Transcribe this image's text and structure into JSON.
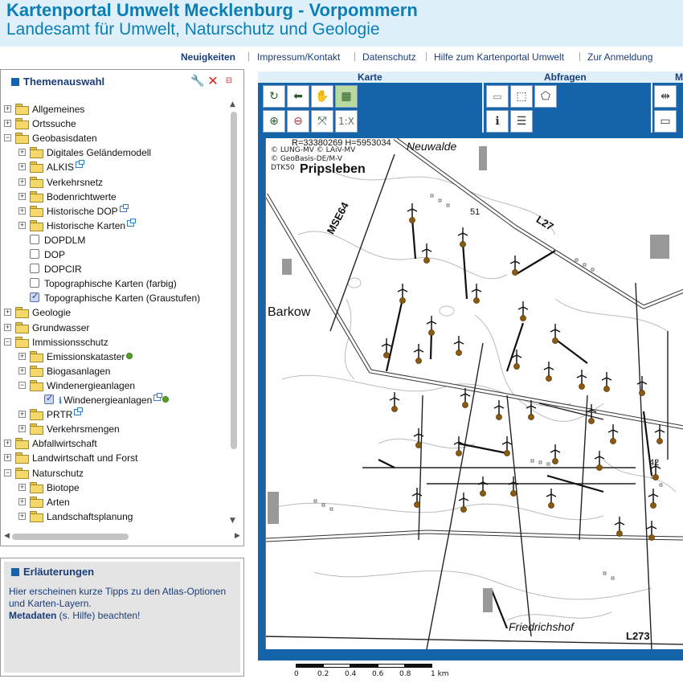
{
  "header": {
    "title": "Kartenportal Umwelt Mecklenburg - Vorpommern",
    "subtitle": "Landesamt für Umwelt, Naturschutz und Geologie"
  },
  "topnav": [
    "Neuigkeiten",
    "Impressum/Kontakt",
    "Datenschutz",
    "Hilfe zum Kartenportal Umwelt",
    "Zur Anmeldung"
  ],
  "theme_panel": {
    "title": "Themenauswahl",
    "tools": [
      "wrench-icon",
      "delete-icon",
      "collapse-icon"
    ],
    "tree": [
      {
        "label": "Allgemeines",
        "level": 0,
        "kind": "folder",
        "expander": "+"
      },
      {
        "label": "Ortssuche",
        "level": 0,
        "kind": "folder",
        "expander": "+"
      },
      {
        "label": "Geobasisdaten",
        "level": 0,
        "kind": "folder",
        "expander": "-"
      },
      {
        "label": "Digitales Geländemodell",
        "level": 1,
        "kind": "folder",
        "expander": "+"
      },
      {
        "label": "ALKIS",
        "level": 1,
        "kind": "folder",
        "expander": "+",
        "ext": true
      },
      {
        "label": "Verkehrsnetz",
        "level": 1,
        "kind": "folder",
        "expander": "+"
      },
      {
        "label": "Bodenrichtwerte",
        "level": 1,
        "kind": "folder",
        "expander": "+"
      },
      {
        "label": "Historische DOP",
        "level": 1,
        "kind": "folder",
        "expander": "+",
        "ext": true
      },
      {
        "label": "Historische Karten",
        "level": 1,
        "kind": "folder",
        "expander": "+",
        "ext": true
      },
      {
        "label": "DOPDLM",
        "level": 1,
        "kind": "check",
        "checked": false
      },
      {
        "label": "DOP",
        "level": 1,
        "kind": "check",
        "checked": false
      },
      {
        "label": "DOPCIR",
        "level": 1,
        "kind": "check",
        "checked": false
      },
      {
        "label": "Topographische Karten (farbig)",
        "level": 1,
        "kind": "check",
        "checked": false
      },
      {
        "label": "Topographische Karten (Graustufen)",
        "level": 1,
        "kind": "check",
        "checked": true
      },
      {
        "label": "Geologie",
        "level": 0,
        "kind": "folder",
        "expander": "+"
      },
      {
        "label": "Grundwasser",
        "level": 0,
        "kind": "folder",
        "expander": "+"
      },
      {
        "label": "Immissionsschutz",
        "level": 0,
        "kind": "folder",
        "expander": "-"
      },
      {
        "label": "Emissionskataster",
        "level": 1,
        "kind": "folder",
        "expander": "+",
        "dot": true
      },
      {
        "label": "Biogasanlagen",
        "level": 1,
        "kind": "folder",
        "expander": "+"
      },
      {
        "label": "Windenergieanlagen",
        "level": 1,
        "kind": "folder",
        "expander": "-"
      },
      {
        "label": "Windenergieanlagen",
        "level": 2,
        "kind": "check",
        "checked": true,
        "info": true,
        "ext": true,
        "dot": true
      },
      {
        "label": "PRTR",
        "level": 1,
        "kind": "folder",
        "expander": "+",
        "ext": true
      },
      {
        "label": "Verkehrsmengen",
        "level": 1,
        "kind": "folder",
        "expander": "+"
      },
      {
        "label": "Abfallwirtschaft",
        "level": 0,
        "kind": "folder",
        "expander": "+"
      },
      {
        "label": "Landwirtschaft und Forst",
        "level": 0,
        "kind": "folder",
        "expander": "+"
      },
      {
        "label": "Naturschutz",
        "level": 0,
        "kind": "folder",
        "expander": "-"
      },
      {
        "label": "Biotope",
        "level": 1,
        "kind": "folder",
        "expander": "+"
      },
      {
        "label": "Arten",
        "level": 1,
        "kind": "folder",
        "expander": "+"
      },
      {
        "label": "Landschaftsplanung",
        "level": 1,
        "kind": "folder",
        "expander": "+"
      }
    ]
  },
  "expl_panel": {
    "title": "Erläuterungen",
    "text_1": "Hier erscheinen kurze Tipps zu den Atlas-Optionen und Karten-Layern.",
    "bold": "Metadaten",
    "text_2": " (s. Hilfe) beachten!"
  },
  "toolbar": {
    "groups": [
      "Karte",
      "Abfragen",
      "M"
    ],
    "scale_button": "1:X"
  },
  "map": {
    "coords": "R=33380269 H=5953034",
    "copyright": [
      "© LUNG-MV © LAiV-MV",
      "© GeoBasis-DE/M-V",
      "DTK50"
    ],
    "places": [
      "Pripsleben",
      "Barkow",
      "Friedrichshof",
      "Neuwalde"
    ],
    "roads": [
      "MSE64",
      "L27",
      "L273"
    ],
    "numbers": [
      "51",
      "42"
    ]
  },
  "scalebar": {
    "labels": [
      "0",
      "0.2",
      "0.4",
      "0.6",
      "0.8",
      "1 km"
    ]
  },
  "colors": {
    "brand": "#0a7eb5",
    "nav": "#1a3d7a",
    "frame": "#1563a9"
  }
}
